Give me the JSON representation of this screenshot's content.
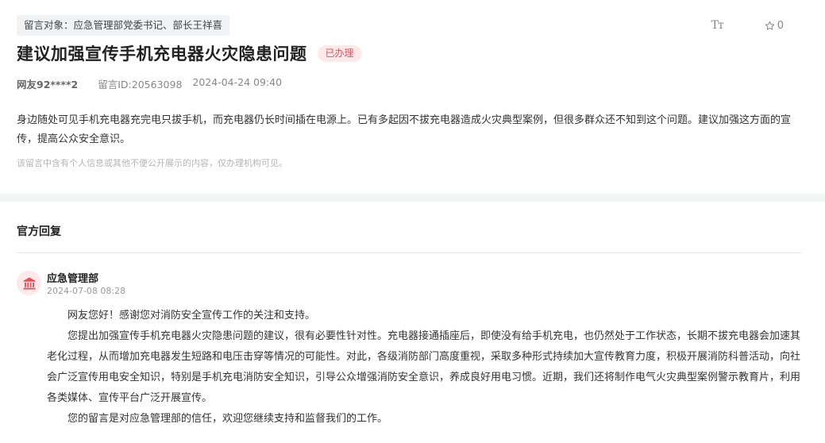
{
  "message": {
    "target": "留言对象：应急管理部党委书记、部长王祥喜",
    "font_toggle": "Tт",
    "favorites_count": "0",
    "title": "建议加强宣传手机充电器火灾隐患问题",
    "status": "已办理",
    "user": "网友92****2",
    "message_id": "留言ID:20563098",
    "datetime": "2024-04-24 09:40",
    "content": "身边随处可见手机充电器充完电只拔手机，而充电器仍长时间插在电源上。已有多起因不拔充电器造成火灾典型案例，但很多群众还不知到这个问题。建议加强这方面的宣传，提高公众安全意识。",
    "privacy_note": "该留言中含有个人信息或其他不便公开展示的内容，仅办理机构可见。"
  },
  "reply": {
    "section_title": "官方回复",
    "organization": "应急管理部",
    "datetime": "2024-07-08 08:28",
    "paragraphs": [
      "网友您好！感谢您对消防安全宣传工作的关注和支持。",
      "您提出加强宣传手机充电器火灾隐患问题的建议，很有必要性针对性。充电器接通插座后，即使没有给手机充电，也仍然处于工作状态，长期不拔充电器会加速其老化过程，从而增加充电器发生短路和电压击穿等情况的可能性。对此，各级消防部门高度重视，采取多种形式持续加大宣传教育力度，积极开展消防科普活动，向社会广泛宣传用电安全知识，特别是手机充电消防安全知识，引导公众增强消防安全意识，养成良好用电习惯。近期，我们还将制作电气火灾典型案例警示教育片，利用各类媒体、宣传平台广泛开展宣传。",
      "您的留言是对应急管理部的信任，欢迎您继续支持和监督我们的工作。"
    ]
  },
  "icons": {
    "font": "font-size-icon",
    "star": "star-icon",
    "avatar": "government-building-icon"
  },
  "colors": {
    "status_text": "#e0505a",
    "status_bg": "#fde9ea",
    "avatar_icon": "#e0505a"
  }
}
